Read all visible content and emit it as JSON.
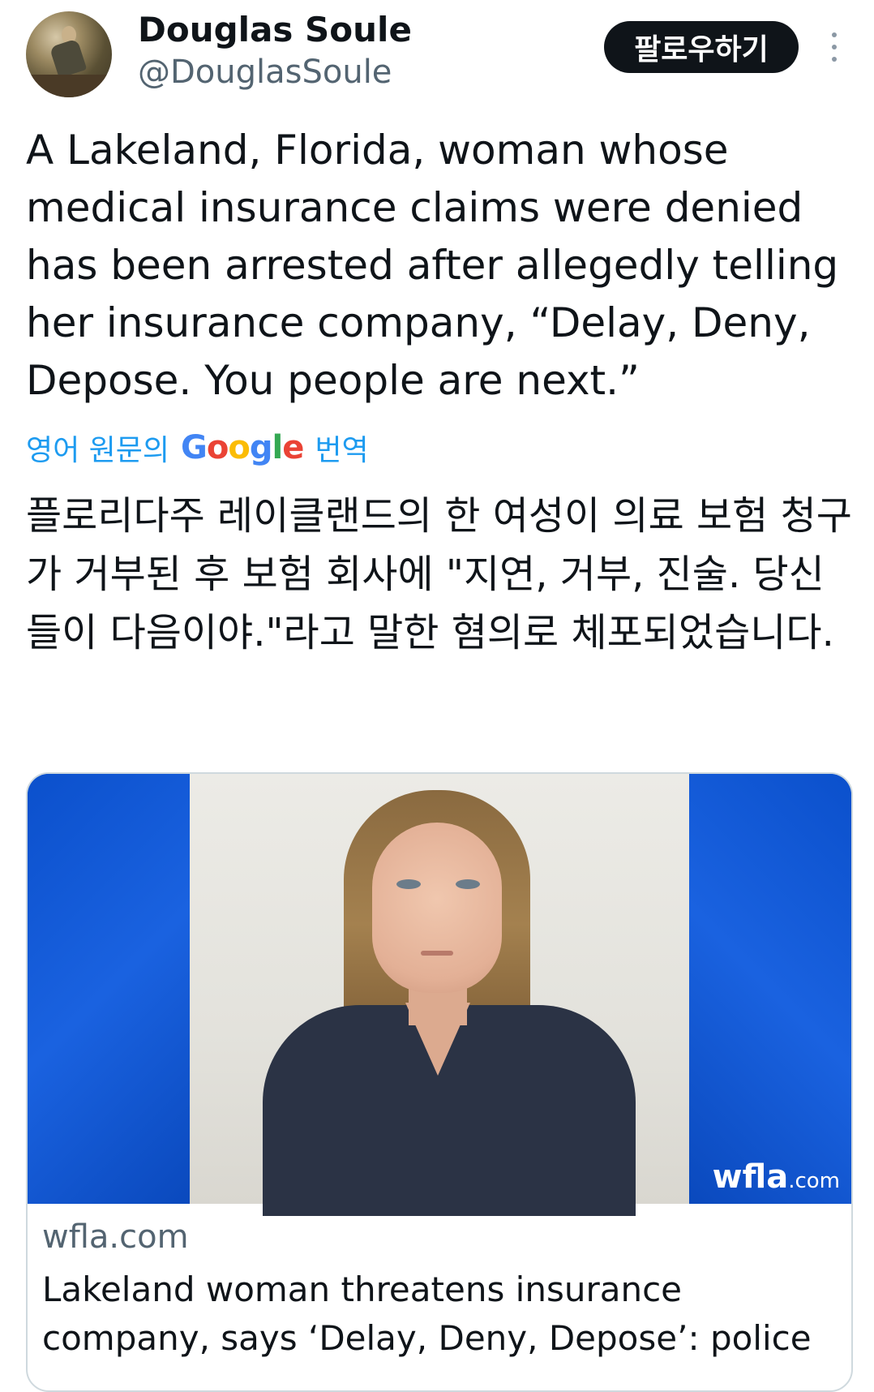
{
  "author": {
    "display_name": "Douglas Soule",
    "handle": "@DouglasSoule"
  },
  "actions": {
    "follow_label": "팔로우하기",
    "more_icon": "more-vertical-icon"
  },
  "tweet": {
    "text": "A Lakeland, Florida, woman whose medical insurance claims were denied has been arrested after allegedly telling her insurance company, “Delay, Deny, Depose. You people are next.”"
  },
  "translation": {
    "prefix": "영어 원문의",
    "brand": "Google",
    "suffix": "번역",
    "text": "플로리다주 레이클랜드의 한 여성이 의료 보험 청구가 거부된 후 보험 회사에 \"지연, 거부, 진술. 당신들이 다음이야.\"라고 말한 혐의로 체포되었습니다."
  },
  "card": {
    "watermark": "wfla",
    "watermark_suffix": ".com",
    "domain": "wfla.com",
    "title": "Lakeland woman threatens insurance company, says ‘Delay, Deny, Depose’: police"
  },
  "colors": {
    "accent": "#1d9bf0",
    "follow_bg": "#0f1419",
    "card_blue": "#0b56d6"
  }
}
